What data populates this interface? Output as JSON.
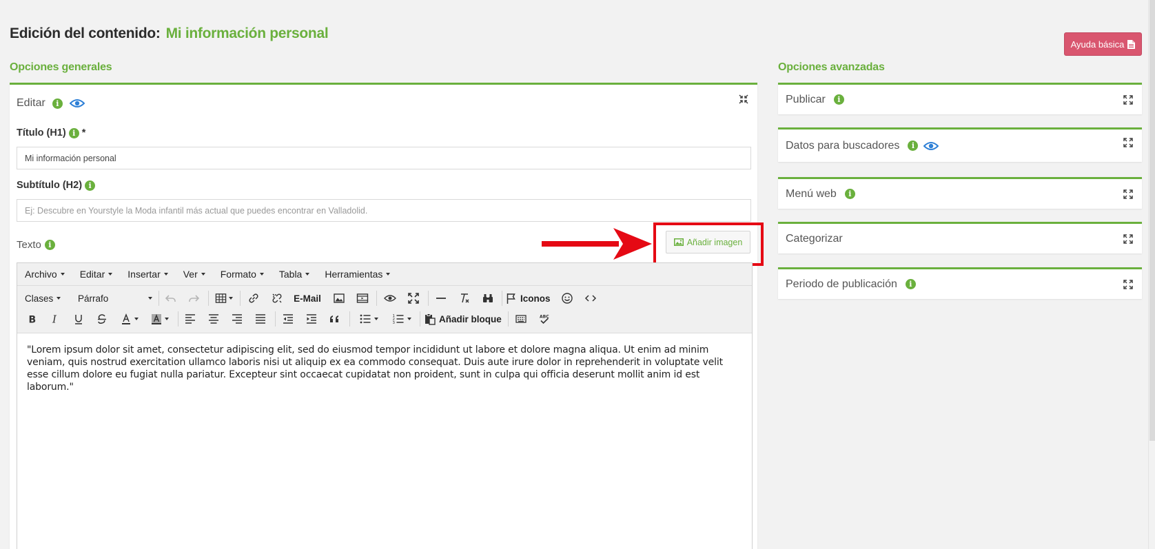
{
  "header": {
    "title": "Edición del contenido:",
    "content_name": "Mi información personal",
    "help_button": "Ayuda básica"
  },
  "general": {
    "heading": "Opciones generales",
    "panel_title": "Editar",
    "title_label": "Título (H1)",
    "title_required": "*",
    "title_value": "Mi información personal",
    "subtitle_label": "Subtítulo (H2)",
    "subtitle_placeholder": "Ej: Descubre en Yourstyle la Moda infantil más actual que puedes encontrar en Valladolid.",
    "text_label": "Texto",
    "add_image": "Añadir imagen"
  },
  "editor": {
    "menu": [
      "Archivo",
      "Editar",
      "Insertar",
      "Ver",
      "Formato",
      "Tabla",
      "Herramientas"
    ],
    "classes": "Clases",
    "paragraph": "Párrafo",
    "email": "E-Mail",
    "icons": "Iconos",
    "add_block": "Añadir bloque",
    "content": "\"Lorem ipsum dolor sit amet, consectetur adipiscing elit, sed do eiusmod tempor incididunt ut labore et dolore magna aliqua. Ut enim ad minim veniam, quis nostrud exercitation ullamco laboris nisi ut aliquip ex ea commodo consequat. Duis aute irure dolor in reprehenderit in voluptate velit esse cillum dolore eu fugiat nulla pariatur. Excepteur sint occaecat cupidatat non proident, sunt in culpa qui officia deserunt mollit anim id est laborum.\""
  },
  "advanced": {
    "heading": "Opciones avanzadas",
    "items": [
      {
        "label": "Publicar"
      },
      {
        "label": "Datos para buscadores"
      },
      {
        "label": "Menú web"
      },
      {
        "label": "Categorizar"
      },
      {
        "label": "Periodo de publicación"
      }
    ]
  },
  "colors": {
    "accent": "#6ab03d",
    "help_button": "#d9566f",
    "highlight": "#e50914",
    "eye_icon": "#2d7fd6"
  }
}
